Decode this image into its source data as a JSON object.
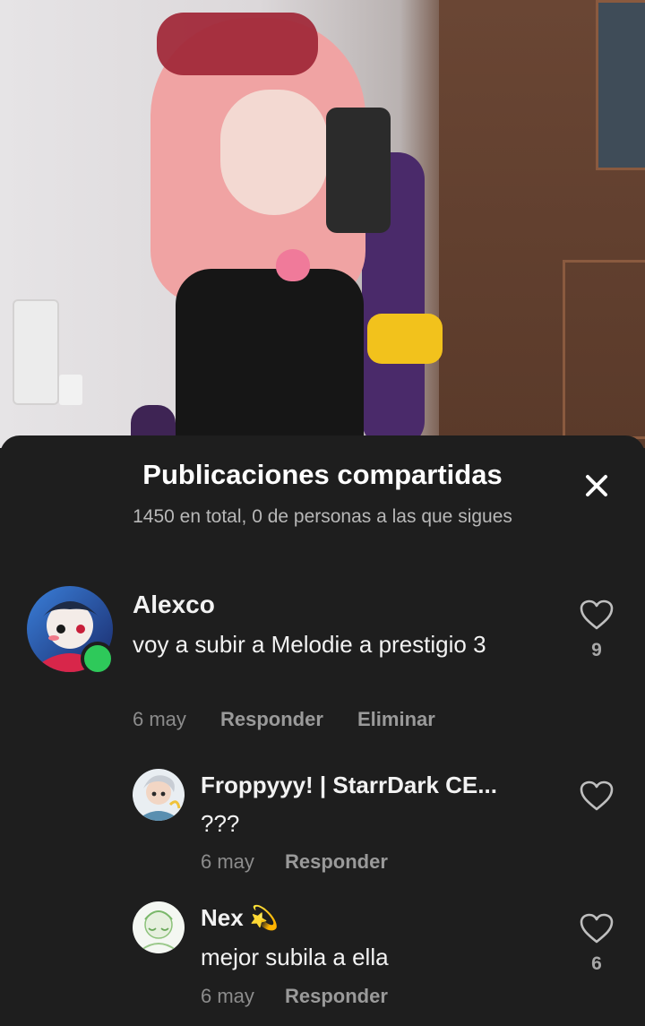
{
  "sheet": {
    "title": "Publicaciones compartidas",
    "subtitle": "1450 en total, 0 de personas a las que sigues",
    "close_icon": "close-icon"
  },
  "comments": [
    {
      "username": "Alexco",
      "text": "voy a subir a Melodie a prestigio 3",
      "date": "6 may",
      "reply_label": "Responder",
      "delete_label": "Eliminar",
      "likes": "9",
      "online": true
    }
  ],
  "replies": [
    {
      "username": "Froppyyy! | StarrDark CE...",
      "text": "???",
      "date": "6 may",
      "reply_label": "Responder"
    },
    {
      "username": "Nex 💫",
      "text": "mejor subila a ella",
      "date": "6 may",
      "reply_label": "Responder",
      "likes": "6"
    }
  ],
  "colors": {
    "sheet_bg": "#1e1e1e",
    "online": "#2ec95a",
    "text_primary": "#f2f2f2",
    "text_secondary": "#8c8c8c"
  }
}
